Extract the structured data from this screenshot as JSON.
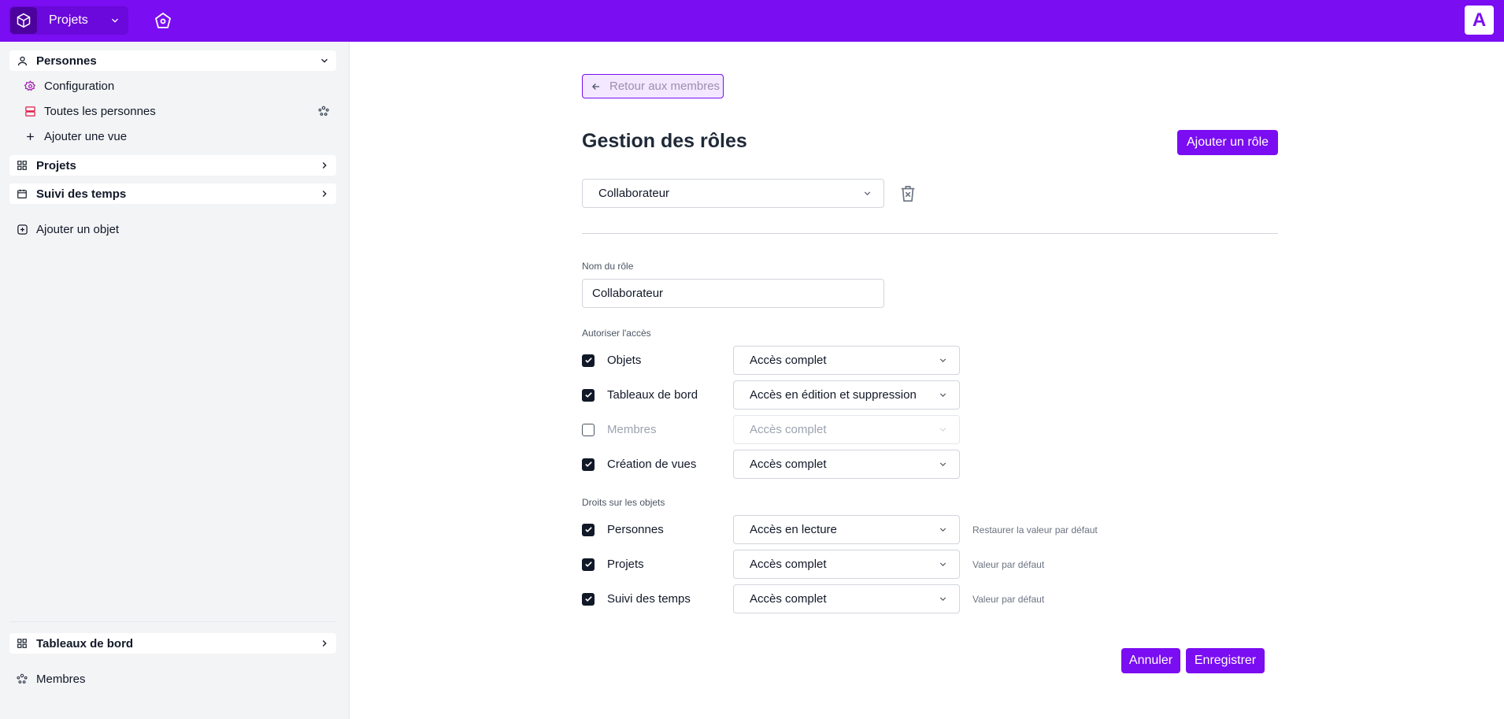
{
  "colors": {
    "brand": "#7a0df2",
    "brand_dark": "#6b08db",
    "sidebar_bg": "#f3f4f6",
    "text": "#111827",
    "muted": "#6b7280"
  },
  "topbar": {
    "project_switch_label": "Projets",
    "avatar_initial": "A",
    "icons": [
      "cube-icon",
      "chevron-down-icon",
      "home-icon"
    ]
  },
  "sidebar": {
    "personnes": {
      "label": "Personnes",
      "items": [
        {
          "label": "Configuration",
          "icon": "settings-icon"
        },
        {
          "label": "Toutes les personnes",
          "icon": "database-icon"
        },
        {
          "label": "Ajouter une vue",
          "icon": "plus-icon"
        }
      ]
    },
    "projets": {
      "label": "Projets"
    },
    "suivi": {
      "label": "Suivi des temps"
    },
    "add_object": {
      "label": "Ajouter un objet"
    },
    "tableaux": {
      "label": "Tableaux de bord"
    },
    "membres": {
      "label": "Membres"
    }
  },
  "main": {
    "back_label": "Retour aux membres",
    "title": "Gestion des rôles",
    "add_role_label": "Ajouter un rôle",
    "role_select_value": "Collaborateur",
    "role_name_label": "Nom du rôle",
    "role_name_value": "Collaborateur",
    "access_section_label": "Autoriser l'accès",
    "access_rows": [
      {
        "label": "Objets",
        "checked": true,
        "value": "Accès complet",
        "disabled": false
      },
      {
        "label": "Tableaux de bord",
        "checked": true,
        "value": "Accès en édition et suppression",
        "disabled": false
      },
      {
        "label": "Membres",
        "checked": false,
        "value": "Accès complet",
        "disabled": true
      },
      {
        "label": "Création de vues",
        "checked": true,
        "value": "Accès complet",
        "disabled": false
      }
    ],
    "objects_section_label": "Droits sur les objets",
    "object_rows": [
      {
        "label": "Personnes",
        "checked": true,
        "value": "Accès en lecture",
        "note": "Restaurer la valeur par défaut"
      },
      {
        "label": "Projets",
        "checked": true,
        "value": "Accès complet",
        "note": "Valeur par défaut"
      },
      {
        "label": "Suivi des temps",
        "checked": true,
        "value": "Accès complet",
        "note": "Valeur par défaut"
      }
    ],
    "cancel_label": "Annuler",
    "save_label": "Enregistrer"
  }
}
